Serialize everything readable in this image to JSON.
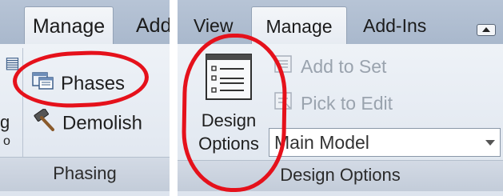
{
  "left_panel": {
    "tabs": {
      "manage": "Manage",
      "add_partial": "Add"
    },
    "partial_glyphs": [
      "g",
      "o"
    ],
    "items": {
      "phases": "Phases",
      "demolish": "Demolish"
    },
    "group_label": "Phasing"
  },
  "right_panel": {
    "tabs": {
      "view": "View",
      "manage": "Manage",
      "addins": "Add-Ins"
    },
    "design_options_button": {
      "line1": "Design",
      "line2": "Options"
    },
    "add_to_set": "Add to Set",
    "pick_to_edit": "Pick to Edit",
    "model_select": {
      "value": "Main Model"
    },
    "group_label": "Design Options"
  },
  "colors": {
    "highlight": "#e5111b",
    "ribbon_tab_bg": "#b7c4d6",
    "panel_bg": "#e6ebf2"
  },
  "icons": {
    "phases": "phases-icon",
    "demolish": "hammer-icon",
    "design_options": "list-icon",
    "add_to_set": "add-to-set-icon",
    "pick_to_edit": "pick-to-edit-icon",
    "collapse": "ribbon-collapse-icon",
    "dropdown": "chevron-down-icon"
  }
}
